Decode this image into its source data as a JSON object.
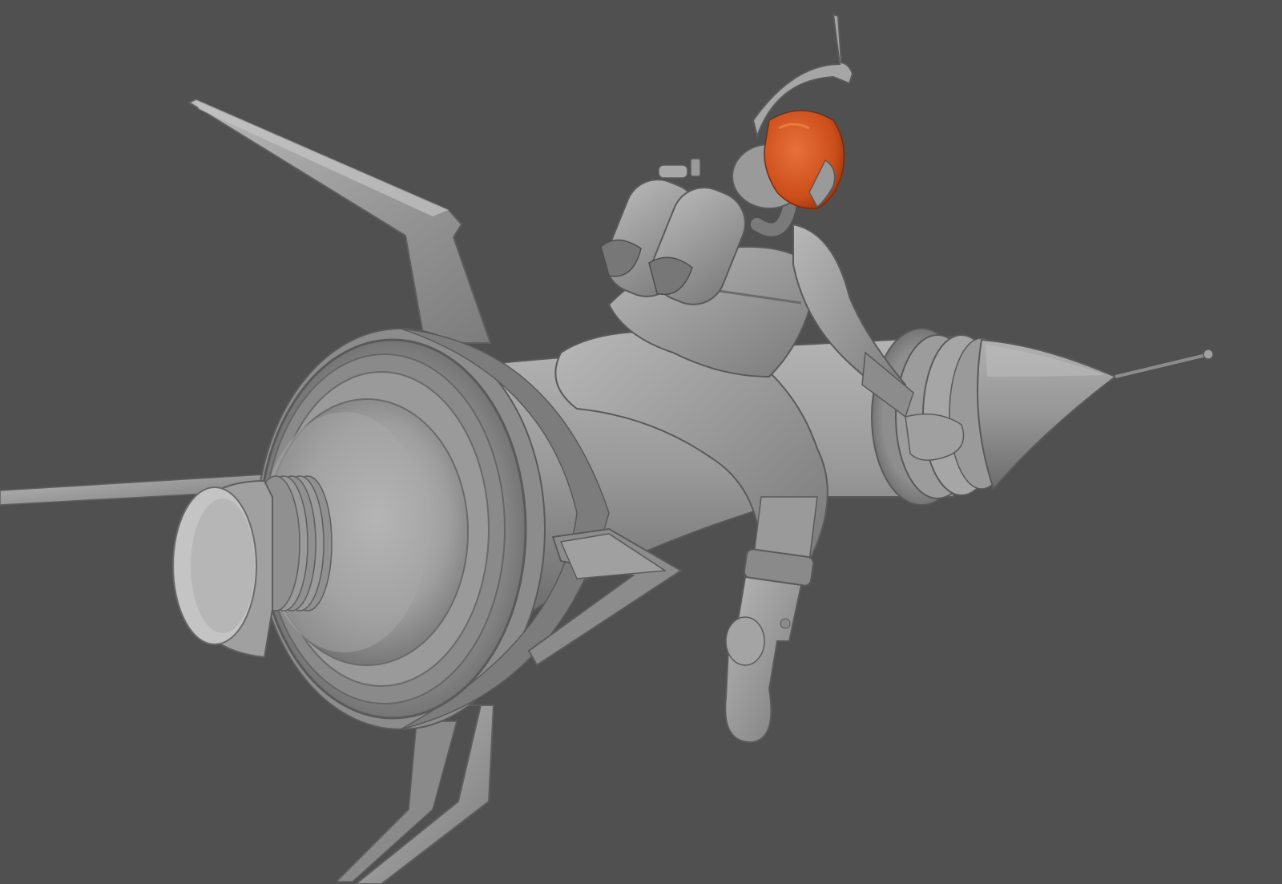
{
  "scene": {
    "background_color": "#505050",
    "clay_color": "#9a9a9a",
    "hair_color": "#d2541e",
    "subject": "sculpt-render-rocket-rider"
  }
}
